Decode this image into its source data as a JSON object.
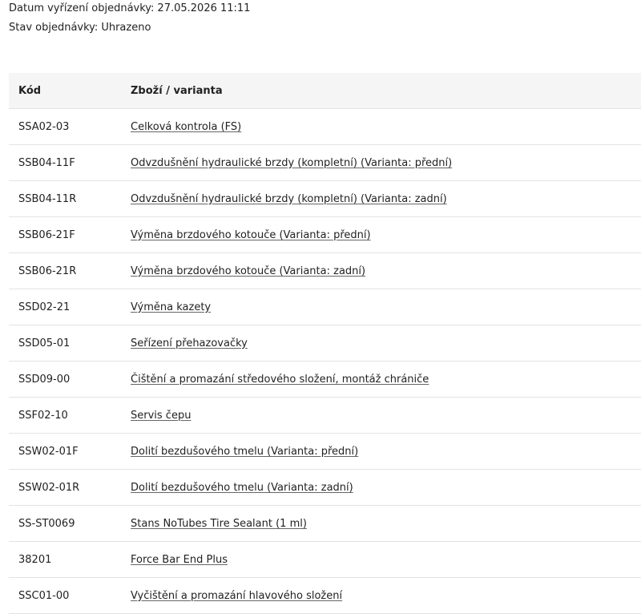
{
  "order": {
    "date_label": "Datum vyřízení objednávky:",
    "date_value": "27.05.2026 11:11",
    "status_label": "Stav objednávky:",
    "status_value": "Uhrazeno"
  },
  "table": {
    "headers": [
      "Kód",
      "Zboží / varianta"
    ],
    "rows": [
      {
        "code": "SSA02-03",
        "name": "Celková kontrola (FS)"
      },
      {
        "code": "SSB04-11F",
        "name": "Odvzdušnění hydraulické brzdy (kompletní) (Varianta: přední)"
      },
      {
        "code": "SSB04-11R",
        "name": "Odvzdušnění hydraulické brzdy (kompletní) (Varianta: zadní)"
      },
      {
        "code": "SSB06-21F",
        "name": "Výměna brzdového kotouče (Varianta: přední)"
      },
      {
        "code": "SSB06-21R",
        "name": "Výměna brzdového kotouče (Varianta: zadní)"
      },
      {
        "code": "SSD02-21",
        "name": "Výměna kazety"
      },
      {
        "code": "SSD05-01",
        "name": "Seřízení přehazovačky"
      },
      {
        "code": "SSD09-00",
        "name": "Čištění a promazání středového složení, montáž chrániče"
      },
      {
        "code": "SSF02-10",
        "name": "Servis čepu"
      },
      {
        "code": "SSW02-01F",
        "name": "Dolití bezdušového tmelu (Varianta: přední)"
      },
      {
        "code": "SSW02-01R",
        "name": "Dolití bezdušového tmelu (Varianta: zadní)"
      },
      {
        "code": "SS-ST0069",
        "name": "Stans NoTubes Tire Sealant (1 ml)"
      },
      {
        "code": "38201",
        "name": "Force Bar End Plus"
      },
      {
        "code": "SSC01-00",
        "name": "Vyčištění a promazání hlavového složení"
      }
    ]
  }
}
